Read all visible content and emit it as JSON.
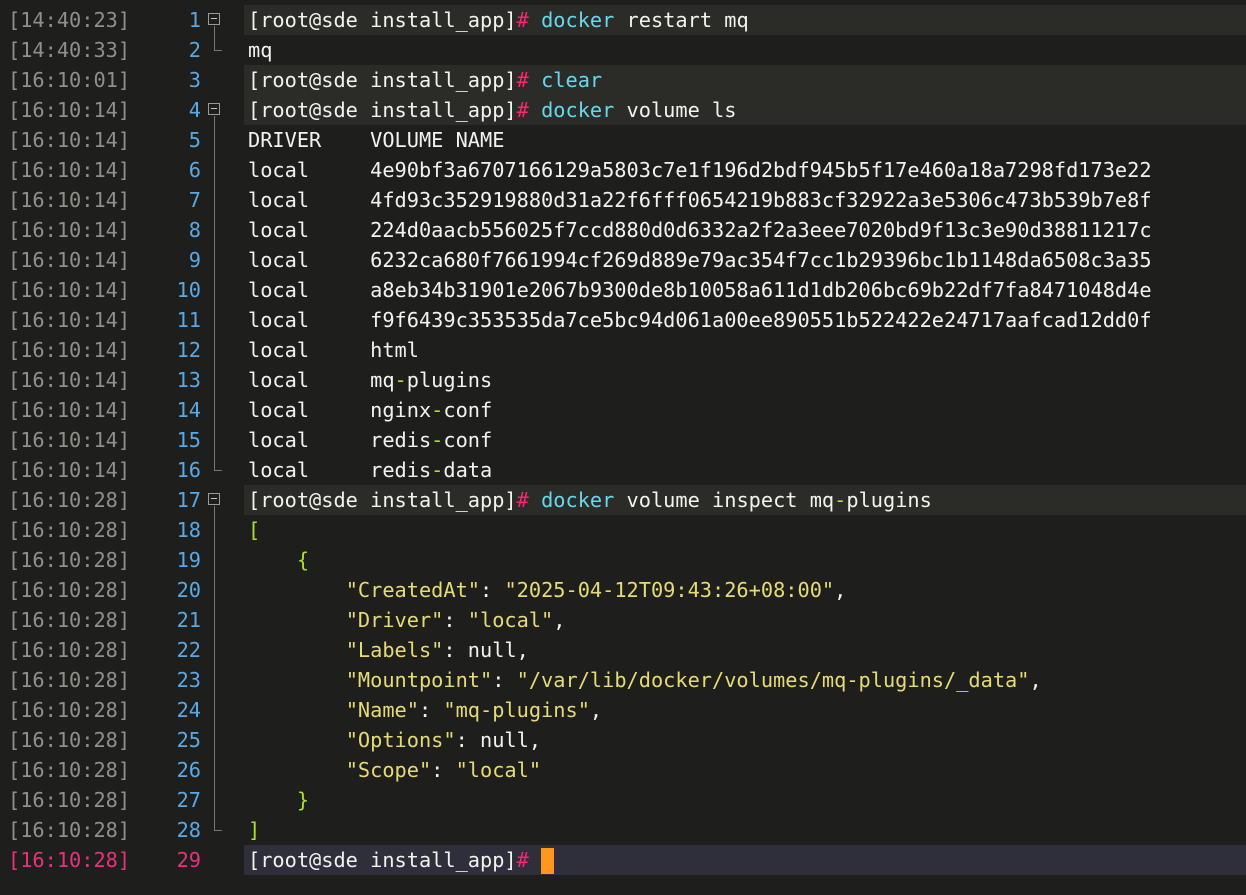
{
  "prompt": "[root@sde install_app]",
  "prompt_symbol": "#",
  "lines": [
    {
      "ts": "[14:40:23]",
      "n": "1",
      "kind": "cmd",
      "fold": "open",
      "text": "docker restart mq"
    },
    {
      "ts": "[14:40:33]",
      "n": "2",
      "kind": "out",
      "fold": "end",
      "text": "mq"
    },
    {
      "ts": "[16:10:01]",
      "n": "3",
      "kind": "cmd",
      "fold": "none",
      "text": "clear"
    },
    {
      "ts": "[16:10:14]",
      "n": "4",
      "kind": "cmd",
      "fold": "open",
      "text": "docker volume ls"
    },
    {
      "ts": "[16:10:14]",
      "n": "5",
      "kind": "out",
      "fold": "mid",
      "text": "DRIVER    VOLUME NAME"
    },
    {
      "ts": "[16:10:14]",
      "n": "6",
      "kind": "out",
      "fold": "mid",
      "text": "local     4e90bf3a6707166129a5803c7e1f196d2bdf945b5f17e460a18a7298fd173e22"
    },
    {
      "ts": "[16:10:14]",
      "n": "7",
      "kind": "out",
      "fold": "mid",
      "text": "local     4fd93c352919880d31a22f6fff0654219b883cf32922a3e5306c473b539b7e8f"
    },
    {
      "ts": "[16:10:14]",
      "n": "8",
      "kind": "out",
      "fold": "mid",
      "text": "local     224d0aacb556025f7ccd880d0d6332a2f2a3eee7020bd9f13c3e90d38811217c"
    },
    {
      "ts": "[16:10:14]",
      "n": "9",
      "kind": "out",
      "fold": "mid",
      "text": "local     6232ca680f7661994cf269d889e79ac354f7cc1b29396bc1b1148da6508c3a35"
    },
    {
      "ts": "[16:10:14]",
      "n": "10",
      "kind": "out",
      "fold": "mid",
      "text": "local     a8eb34b31901e2067b9300de8b10058a611d1db206bc69b22df7fa8471048d4e"
    },
    {
      "ts": "[16:10:14]",
      "n": "11",
      "kind": "out",
      "fold": "mid",
      "text": "local     f9f6439c353535da7ce5bc94d061a00ee890551b522422e24717aafcad12dd0f"
    },
    {
      "ts": "[16:10:14]",
      "n": "12",
      "kind": "out",
      "fold": "mid",
      "text": "local     html"
    },
    {
      "ts": "[16:10:14]",
      "n": "13",
      "kind": "out",
      "fold": "mid",
      "text": "local     mq-plugins"
    },
    {
      "ts": "[16:10:14]",
      "n": "14",
      "kind": "out",
      "fold": "mid",
      "text": "local     nginx-conf"
    },
    {
      "ts": "[16:10:14]",
      "n": "15",
      "kind": "out",
      "fold": "mid",
      "text": "local     redis-conf"
    },
    {
      "ts": "[16:10:14]",
      "n": "16",
      "kind": "out",
      "fold": "end",
      "text": "local     redis-data"
    },
    {
      "ts": "[16:10:28]",
      "n": "17",
      "kind": "cmd",
      "fold": "open",
      "text": "docker volume inspect mq-plugins"
    },
    {
      "ts": "[16:10:28]",
      "n": "18",
      "kind": "out",
      "fold": "mid",
      "text": "["
    },
    {
      "ts": "[16:10:28]",
      "n": "19",
      "kind": "out",
      "fold": "mid",
      "text": "    {"
    },
    {
      "ts": "[16:10:28]",
      "n": "20",
      "kind": "out",
      "fold": "mid",
      "text": "        \"CreatedAt\": \"2025-04-12T09:43:26+08:00\","
    },
    {
      "ts": "[16:10:28]",
      "n": "21",
      "kind": "out",
      "fold": "mid",
      "text": "        \"Driver\": \"local\","
    },
    {
      "ts": "[16:10:28]",
      "n": "22",
      "kind": "out",
      "fold": "mid",
      "text": "        \"Labels\": null,"
    },
    {
      "ts": "[16:10:28]",
      "n": "23",
      "kind": "out",
      "fold": "mid",
      "text": "        \"Mountpoint\": \"/var/lib/docker/volumes/mq-plugins/_data\","
    },
    {
      "ts": "[16:10:28]",
      "n": "24",
      "kind": "out",
      "fold": "mid",
      "text": "        \"Name\": \"mq-plugins\","
    },
    {
      "ts": "[16:10:28]",
      "n": "25",
      "kind": "out",
      "fold": "mid",
      "text": "        \"Options\": null,"
    },
    {
      "ts": "[16:10:28]",
      "n": "26",
      "kind": "out",
      "fold": "mid",
      "text": "        \"Scope\": \"local\""
    },
    {
      "ts": "[16:10:28]",
      "n": "27",
      "kind": "out",
      "fold": "mid",
      "text": "    }"
    },
    {
      "ts": "[16:10:28]",
      "n": "28",
      "kind": "out",
      "fold": "end",
      "text": "]"
    },
    {
      "ts": "[16:10:28]",
      "n": "29",
      "kind": "current",
      "fold": "none",
      "text": ""
    }
  ],
  "colors": {
    "background": "#1e1f1c",
    "timestamp": "#8f908a",
    "line_number": "#5aa9e6",
    "current_line": "#e8317d",
    "prompt_hash": "#f92672",
    "command": "#66d9ef",
    "string": "#e6db74",
    "punctuation": "#a6e22e",
    "cursor": "#fd971f"
  }
}
